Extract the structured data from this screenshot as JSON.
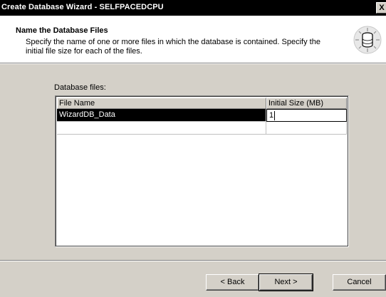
{
  "window": {
    "title": "Create Database Wizard - SELFPACEDCPU",
    "close_label": "X"
  },
  "header": {
    "title": "Name the Database Files",
    "description": "Specify the name of one or more files in which the database is contained. Specify the initial file size for each of the files.",
    "icon": "database-icon"
  },
  "files": {
    "label": "Database files:",
    "columns": [
      "File Name",
      "Initial Size (MB)"
    ],
    "rows": [
      {
        "name": "WizardDB_Data",
        "size": "1"
      },
      {
        "name": "",
        "size": ""
      }
    ]
  },
  "buttons": {
    "back": "< Back",
    "next": "Next >",
    "cancel": "Cancel"
  },
  "colors": {
    "titlebar": "#000000",
    "face": "#d4d0c8",
    "selection": "#000000"
  }
}
